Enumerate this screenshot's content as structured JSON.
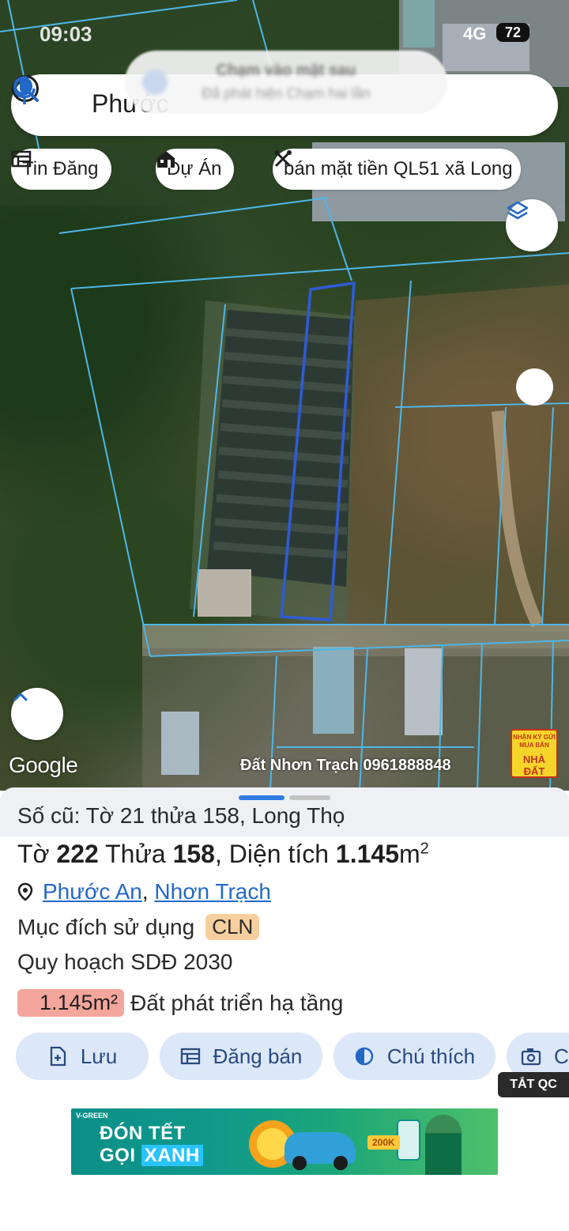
{
  "status_bar": {
    "time": "09:03",
    "network": "4G",
    "battery": "72"
  },
  "search": {
    "query": "Phước",
    "notification_title": "Chạm vào mặt sau",
    "notification_body": "Đã phát hiện Chạm hai lần"
  },
  "chips": [
    {
      "label": "Tin Đăng",
      "icon": "table-icon"
    },
    {
      "label": "Dự Án",
      "icon": "building-icon"
    },
    {
      "label": "bán mặt tiền QL51 xã Long",
      "icon": "tools-icon"
    }
  ],
  "map": {
    "attribution": "Google",
    "watermark": "Đất Nhơn Trạch 0961888848",
    "badge_line1": "NHẬN KÝ GỬI",
    "badge_line2": "MUA BÁN",
    "badge_line3": "NHÀ ĐẤT"
  },
  "parcel": {
    "old_info": "Số cũ: Tờ 21 thửa 158, Long Thọ",
    "sheet_label": "Tờ",
    "sheet_no": "222",
    "parcel_label": "Thửa",
    "parcel_no": "158",
    "area_label": ", Diện tích",
    "area_value": "1.145",
    "area_unit": "m",
    "area_unit_sup": "2",
    "ward": "Phước An",
    "district": "Nhơn Trạch",
    "purpose_label": "Mục đích sử dụng",
    "purpose_code": "CLN",
    "plan_label": "Quy hoạch SDĐ 2030",
    "zone_area": "1.145m²",
    "zone_label": "Đất phát triển hạ tầng"
  },
  "actions": [
    {
      "label": "Lưu",
      "icon": "save-icon"
    },
    {
      "label": "Đăng bán",
      "icon": "post-icon"
    },
    {
      "label": "Chú thích",
      "icon": "legend-icon"
    },
    {
      "label": "C",
      "icon": "camera-icon"
    }
  ],
  "ads": {
    "close_label": "TẮT QC",
    "banner_brand": "V-GREEN",
    "banner_line1": "ĐÓN TẾT",
    "banner_line2a": "GỌI",
    "banner_line2b": "XANH",
    "banner_promo": "200K"
  },
  "colors": {
    "accent": "#2468c6",
    "parcel_outline": "#2f5bd8",
    "plot_lines": "#4fb6e6",
    "action_bg": "#dce7f8",
    "zone_bg": "#f4a69c",
    "purpose_tag": "#f7cf9e"
  }
}
